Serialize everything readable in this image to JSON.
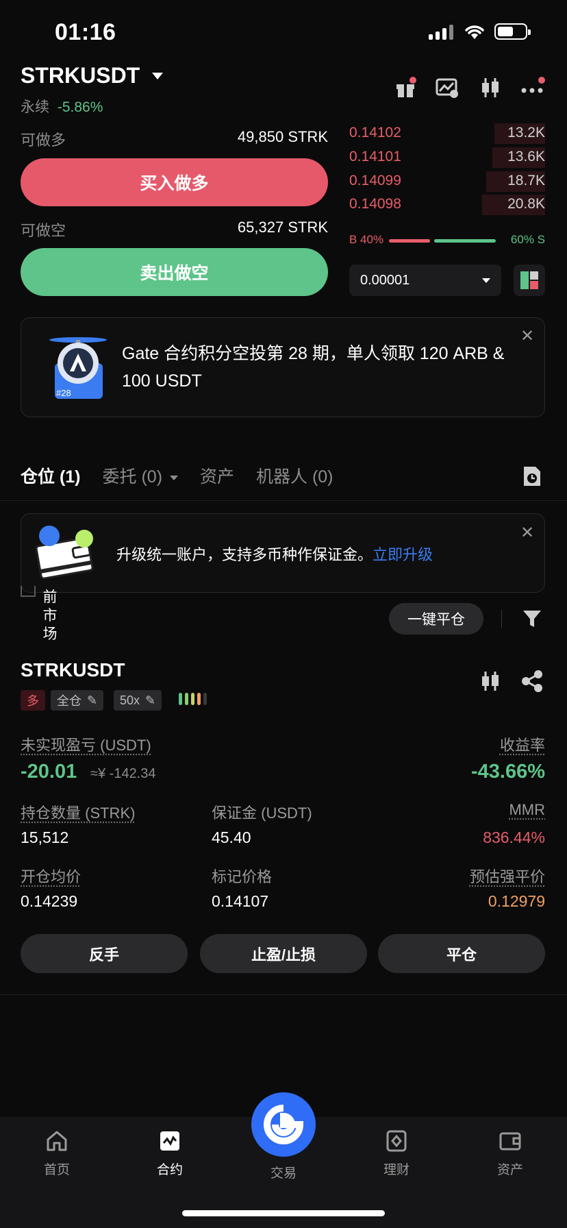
{
  "status_bar": {
    "time": "01:16"
  },
  "header": {
    "pair": "STRKUSDT",
    "contract_type": "永续",
    "change": "-5.86%"
  },
  "trade": {
    "long_label": "可做多",
    "long_value": "49,850 STRK",
    "long_button": "买入做多",
    "short_label": "可做空",
    "short_value": "65,327 STRK",
    "short_button": "卖出做空"
  },
  "orderbook": {
    "asks": [
      {
        "price": "0.14102",
        "qty": "13.2K",
        "depth": 0.26
      },
      {
        "price": "0.14101",
        "qty": "13.6K",
        "depth": 0.27
      },
      {
        "price": "0.14099",
        "qty": "18.7K",
        "depth": 0.3
      },
      {
        "price": "0.14098",
        "qty": "20.8K",
        "depth": 0.32
      }
    ],
    "buy_ratio": "B 40%",
    "sell_ratio": "60% S",
    "buy_fraction": 0.4,
    "tick_size": "0.00001"
  },
  "promo": {
    "title": "Gate 合约积分空投第 28 期，单人领取 120 ARB & 100 USDT",
    "badge": "#28"
  },
  "tabs": {
    "positions": "仓位 (1)",
    "orders": "委托 (0)",
    "assets": "资产",
    "bots": "机器人 (0)"
  },
  "notice": {
    "text": "升级统一账户，支持多币种作保证金。",
    "link": "立即升级"
  },
  "filters": {
    "current_market": "前市场",
    "close_all": "一键平仓"
  },
  "position": {
    "pair": "STRKUSDT",
    "side": "多",
    "margin_mode": "全仓",
    "leverage": "50x",
    "unrealized_pnl_label": "未实现盈亏 (USDT)",
    "unrealized_pnl": "-20.01",
    "unrealized_pnl_cny": "≈¥ -142.34",
    "roe_label": "收益率",
    "roe": "-43.66%",
    "size_label": "持仓数量 (STRK)",
    "size": "15,512",
    "margin_label": "保证金 (USDT)",
    "margin": "45.40",
    "mmr_label": "MMR",
    "mmr": "836.44%",
    "entry_label": "开仓均价",
    "entry": "0.14239",
    "mark_label": "标记价格",
    "mark": "0.14107",
    "liq_label": "预估强平价",
    "liq": "0.12979"
  },
  "actions": {
    "reverse": "反手",
    "tpsl": "止盈/止损",
    "close": "平仓"
  },
  "bottom_nav": [
    {
      "label": "首页",
      "icon": "home-icon"
    },
    {
      "label": "合约",
      "icon": "futures-icon"
    },
    {
      "label": "交易",
      "icon": "trade-logo-icon"
    },
    {
      "label": "理财",
      "icon": "earn-icon"
    },
    {
      "label": "资产",
      "icon": "wallet-icon"
    }
  ],
  "colors": {
    "long": "#e6596b",
    "short": "#5ec48a",
    "accent": "#2f6df6",
    "link": "#3b7df0"
  }
}
